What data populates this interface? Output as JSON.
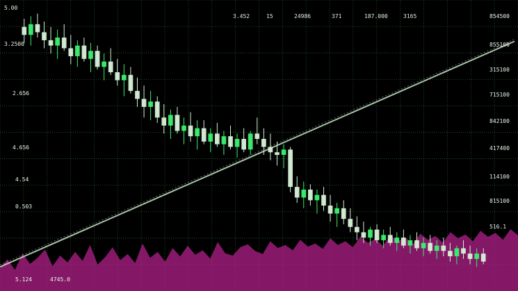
{
  "chart_data": {
    "type": "candlestick",
    "title": "",
    "xlabel": "",
    "ylabel": "",
    "grid": true,
    "colors": {
      "background": "#000000",
      "up": "#3cf070",
      "down": "#d8f0d8",
      "grid": "#2a6a3a",
      "volume": "#b0208a",
      "trend": "#c8e6c8"
    },
    "left_axis_ticks": [
      "5.00",
      "3.2500",
      "2.656",
      "4.656",
      "4.54",
      "0.503"
    ],
    "right_axis_ticks": [
      "854500",
      "855100",
      "315100",
      "715100",
      "842100",
      "417400",
      "114100",
      "815100",
      "516.1"
    ],
    "top_labels": [
      "3.452",
      "15",
      "24986",
      "371",
      "187.000",
      "3165"
    ],
    "bottom_labels": [
      "5.124",
      "4745.0"
    ],
    "ylim": [
      0,
      100
    ],
    "candles": [
      [
        92,
        95,
        86,
        89
      ],
      [
        89,
        96,
        85,
        93
      ],
      [
        93,
        97,
        88,
        90
      ],
      [
        90,
        94,
        84,
        87
      ],
      [
        87,
        92,
        82,
        85
      ],
      [
        85,
        91,
        80,
        88
      ],
      [
        88,
        93,
        83,
        84
      ],
      [
        84,
        89,
        78,
        81
      ],
      [
        81,
        87,
        77,
        85
      ],
      [
        85,
        88,
        79,
        80
      ],
      [
        80,
        86,
        75,
        83
      ],
      [
        83,
        85,
        76,
        77
      ],
      [
        77,
        82,
        72,
        79
      ],
      [
        79,
        84,
        74,
        75
      ],
      [
        75,
        80,
        70,
        72
      ],
      [
        72,
        78,
        66,
        74
      ],
      [
        74,
        77,
        67,
        68
      ],
      [
        68,
        73,
        62,
        65
      ],
      [
        65,
        70,
        58,
        62
      ],
      [
        62,
        68,
        57,
        64
      ],
      [
        64,
        66,
        56,
        58
      ],
      [
        58,
        63,
        52,
        55
      ],
      [
        55,
        61,
        50,
        59
      ],
      [
        59,
        62,
        52,
        53
      ],
      [
        53,
        58,
        48,
        55
      ],
      [
        55,
        60,
        49,
        51
      ],
      [
        51,
        57,
        46,
        54
      ],
      [
        54,
        57,
        48,
        49
      ],
      [
        49,
        54,
        45,
        52
      ],
      [
        52,
        56,
        47,
        48
      ],
      [
        48,
        53,
        44,
        51
      ],
      [
        51,
        55,
        46,
        47
      ],
      [
        47,
        52,
        43,
        50
      ],
      [
        50,
        54,
        45,
        46
      ],
      [
        46,
        53,
        44,
        52
      ],
      [
        52,
        58,
        48,
        50
      ],
      [
        50,
        54,
        44,
        47
      ],
      [
        47,
        52,
        42,
        45
      ],
      [
        45,
        49,
        40,
        44
      ],
      [
        44,
        48,
        39,
        46
      ],
      [
        46,
        47,
        30,
        32
      ],
      [
        32,
        36,
        26,
        28
      ],
      [
        28,
        34,
        24,
        31
      ],
      [
        31,
        33,
        25,
        27
      ],
      [
        27,
        31,
        22,
        29
      ],
      [
        29,
        32,
        23,
        25
      ],
      [
        25,
        29,
        19,
        22
      ],
      [
        22,
        26,
        17,
        24
      ],
      [
        24,
        27,
        18,
        20
      ],
      [
        20,
        24,
        15,
        17
      ],
      [
        17,
        21,
        12,
        15
      ],
      [
        15,
        19,
        11,
        13
      ],
      [
        13,
        17,
        10,
        16
      ],
      [
        16,
        18,
        11,
        12
      ],
      [
        12,
        16,
        9,
        14
      ],
      [
        14,
        17,
        10,
        11
      ],
      [
        11,
        15,
        8,
        13
      ],
      [
        13,
        16,
        9,
        10
      ],
      [
        10,
        14,
        7,
        12
      ],
      [
        12,
        15,
        8,
        9
      ],
      [
        9,
        13,
        6,
        11
      ],
      [
        11,
        14,
        7,
        8
      ],
      [
        8,
        12,
        5,
        10
      ],
      [
        10,
        13,
        6,
        8
      ],
      [
        8,
        11,
        4,
        6
      ],
      [
        6,
        10,
        3,
        9
      ],
      [
        9,
        12,
        5,
        7
      ],
      [
        7,
        10,
        3,
        5
      ],
      [
        5,
        9,
        2,
        7
      ],
      [
        7,
        9,
        3,
        4
      ]
    ],
    "trend": [
      2,
      97
    ],
    "volume": [
      30,
      42,
      28,
      50,
      36,
      44,
      55,
      33,
      47,
      38,
      52,
      40,
      61,
      35,
      45,
      58,
      41,
      49,
      37,
      63,
      44,
      52,
      39,
      57,
      46,
      60,
      48,
      54,
      43,
      65,
      50,
      47,
      58,
      62,
      53,
      49,
      66,
      57,
      61,
      54,
      68,
      59,
      63,
      56,
      70,
      61,
      66,
      58,
      72,
      64,
      69,
      60,
      74,
      66,
      71,
      62,
      76,
      68,
      73,
      64,
      78,
      70,
      75,
      66,
      80,
      72,
      77,
      68,
      82,
      74
    ]
  }
}
